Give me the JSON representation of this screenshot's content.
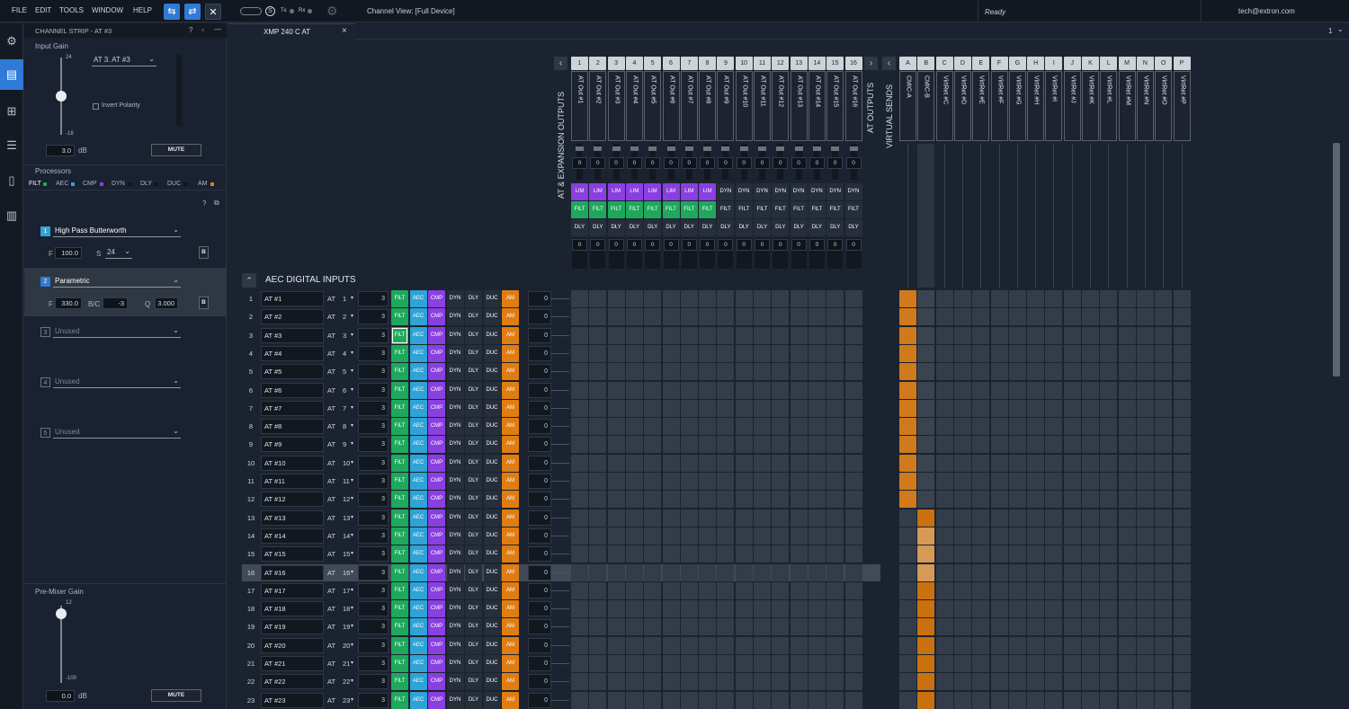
{
  "menu": [
    "FILE",
    "EDIT",
    "TOOLS",
    "WINDOW",
    "HELP"
  ],
  "toolbar": {
    "tx": "Tx",
    "rx": "Rx",
    "channel_view": "Channel View: [Full Device]",
    "status": "Ready",
    "user": "tech@extron.com"
  },
  "strip": {
    "title": "CHANNEL STRIP - AT #3",
    "input_gain_label": "Input Gain",
    "gain_max": "24",
    "gain_min": "-18",
    "gain_value": "3.0",
    "db": "dB",
    "channel_select": "AT 3. AT #3",
    "invert_polarity": "Invert Polarity",
    "mute": "MUTE",
    "processors_label": "Processors",
    "proc_tabs": [
      "FILT",
      "AEC",
      "CMP",
      "DYN",
      "DLY",
      "DUC",
      "AM"
    ],
    "filters": [
      {
        "num": "1",
        "type": "High Pass Butterworth",
        "f_label": "F",
        "f": "100.0",
        "s_label": "S",
        "s": "24",
        "b": "B"
      },
      {
        "num": "2",
        "type": "Parametric",
        "f_label": "F",
        "f": "330.0",
        "bc_label": "B/C",
        "bc": "-3",
        "q_label": "Q",
        "q": "3.000",
        "b": "B"
      },
      {
        "num": "3",
        "type": "Unused"
      },
      {
        "num": "4",
        "type": "Unused"
      },
      {
        "num": "5",
        "type": "Unused"
      }
    ],
    "premixer_label": "Pre-Mixer Gain",
    "pm_max": "12",
    "pm_min": "-100",
    "pm_value": "0.0",
    "pm_db": "dB",
    "pm_mute": "MUTE"
  },
  "tab": {
    "name": "XMP 240 C AT",
    "close": "×",
    "page": "1"
  },
  "matrix": {
    "outputs_group": "AT & EXPANSION OUTPUTS",
    "at_outputs": "AT OUTPUTS",
    "virtual_sends": "VIRTUAL SENDS",
    "inputs_group": "AEC DIGITAL INPUTS",
    "out_nums": [
      "1",
      "2",
      "3",
      "4",
      "5",
      "6",
      "7",
      "8",
      "9",
      "10",
      "11",
      "12",
      "13",
      "14",
      "15",
      "16"
    ],
    "out_names": [
      "AT Out #1",
      "AT Out #2",
      "AT Out #3",
      "AT Out #4",
      "AT Out #5",
      "AT Out #6",
      "AT Out #7",
      "AT Out #8",
      "AT Out #9",
      "AT Out #10",
      "AT Out #11",
      "AT Out #12",
      "AT Out #13",
      "AT Out #14",
      "AT Out #15",
      "AT Out #16"
    ],
    "vs_letters": [
      "A",
      "B",
      "C",
      "D",
      "E",
      "F",
      "G",
      "H",
      "I",
      "J",
      "K",
      "L",
      "M",
      "N",
      "O",
      "P"
    ],
    "vs_names": [
      "CMIC-A",
      "CMIC-B",
      "VirtRet #C",
      "VirtRet #D",
      "VirtRet #E",
      "VirtRet #F",
      "VirtRet #G",
      "VirtRet #H",
      "VirtRet #I",
      "VirtRet #J",
      "VirtRet #K",
      "VirtRet #L",
      "VirtRet #M",
      "VirtRet #N",
      "VirtRet #O",
      "VirtRet #P"
    ],
    "out_gain": "0",
    "out_proc": [
      "LIM",
      "DYN",
      "FILT",
      "DLY"
    ],
    "row_procs": [
      "FILT",
      "AEC",
      "CMP",
      "DYN",
      "DLY",
      "DUC",
      "AM"
    ],
    "row_gain": "3",
    "row_level": "0",
    "at_label": "AT",
    "rows": [
      {
        "n": "1",
        "name": "AT #1",
        "ch": "1"
      },
      {
        "n": "2",
        "name": "AT #2",
        "ch": "2"
      },
      {
        "n": "3",
        "name": "AT #3",
        "ch": "3"
      },
      {
        "n": "4",
        "name": "AT #4",
        "ch": "4"
      },
      {
        "n": "5",
        "name": "AT #5",
        "ch": "5"
      },
      {
        "n": "6",
        "name": "AT #6",
        "ch": "6"
      },
      {
        "n": "7",
        "name": "AT #7",
        "ch": "7"
      },
      {
        "n": "8",
        "name": "AT #8",
        "ch": "8"
      },
      {
        "n": "9",
        "name": "AT #9",
        "ch": "9"
      },
      {
        "n": "10",
        "name": "AT #10",
        "ch": "10"
      },
      {
        "n": "11",
        "name": "AT #11",
        "ch": "11"
      },
      {
        "n": "12",
        "name": "AT #12",
        "ch": "12"
      },
      {
        "n": "13",
        "name": "AT #13",
        "ch": "13"
      },
      {
        "n": "14",
        "name": "AT #14",
        "ch": "14"
      },
      {
        "n": "15",
        "name": "AT #15",
        "ch": "15"
      },
      {
        "n": "16",
        "name": "AT #16",
        "ch": "16"
      },
      {
        "n": "17",
        "name": "AT #17",
        "ch": "17"
      },
      {
        "n": "18",
        "name": "AT #18",
        "ch": "18"
      },
      {
        "n": "19",
        "name": "AT #19",
        "ch": "19"
      },
      {
        "n": "20",
        "name": "AT #20",
        "ch": "20"
      },
      {
        "n": "21",
        "name": "AT #21",
        "ch": "21"
      },
      {
        "n": "22",
        "name": "AT #22",
        "ch": "22"
      },
      {
        "n": "23",
        "name": "AT #23",
        "ch": "23"
      }
    ]
  },
  "colors": {
    "filt": "#1fa85c",
    "aec": "#2fa3d6",
    "cmp": "#8a3fe0",
    "am": "#e07d12",
    "lim": "#8a3fe0",
    "accent": "#2f7ad6"
  }
}
